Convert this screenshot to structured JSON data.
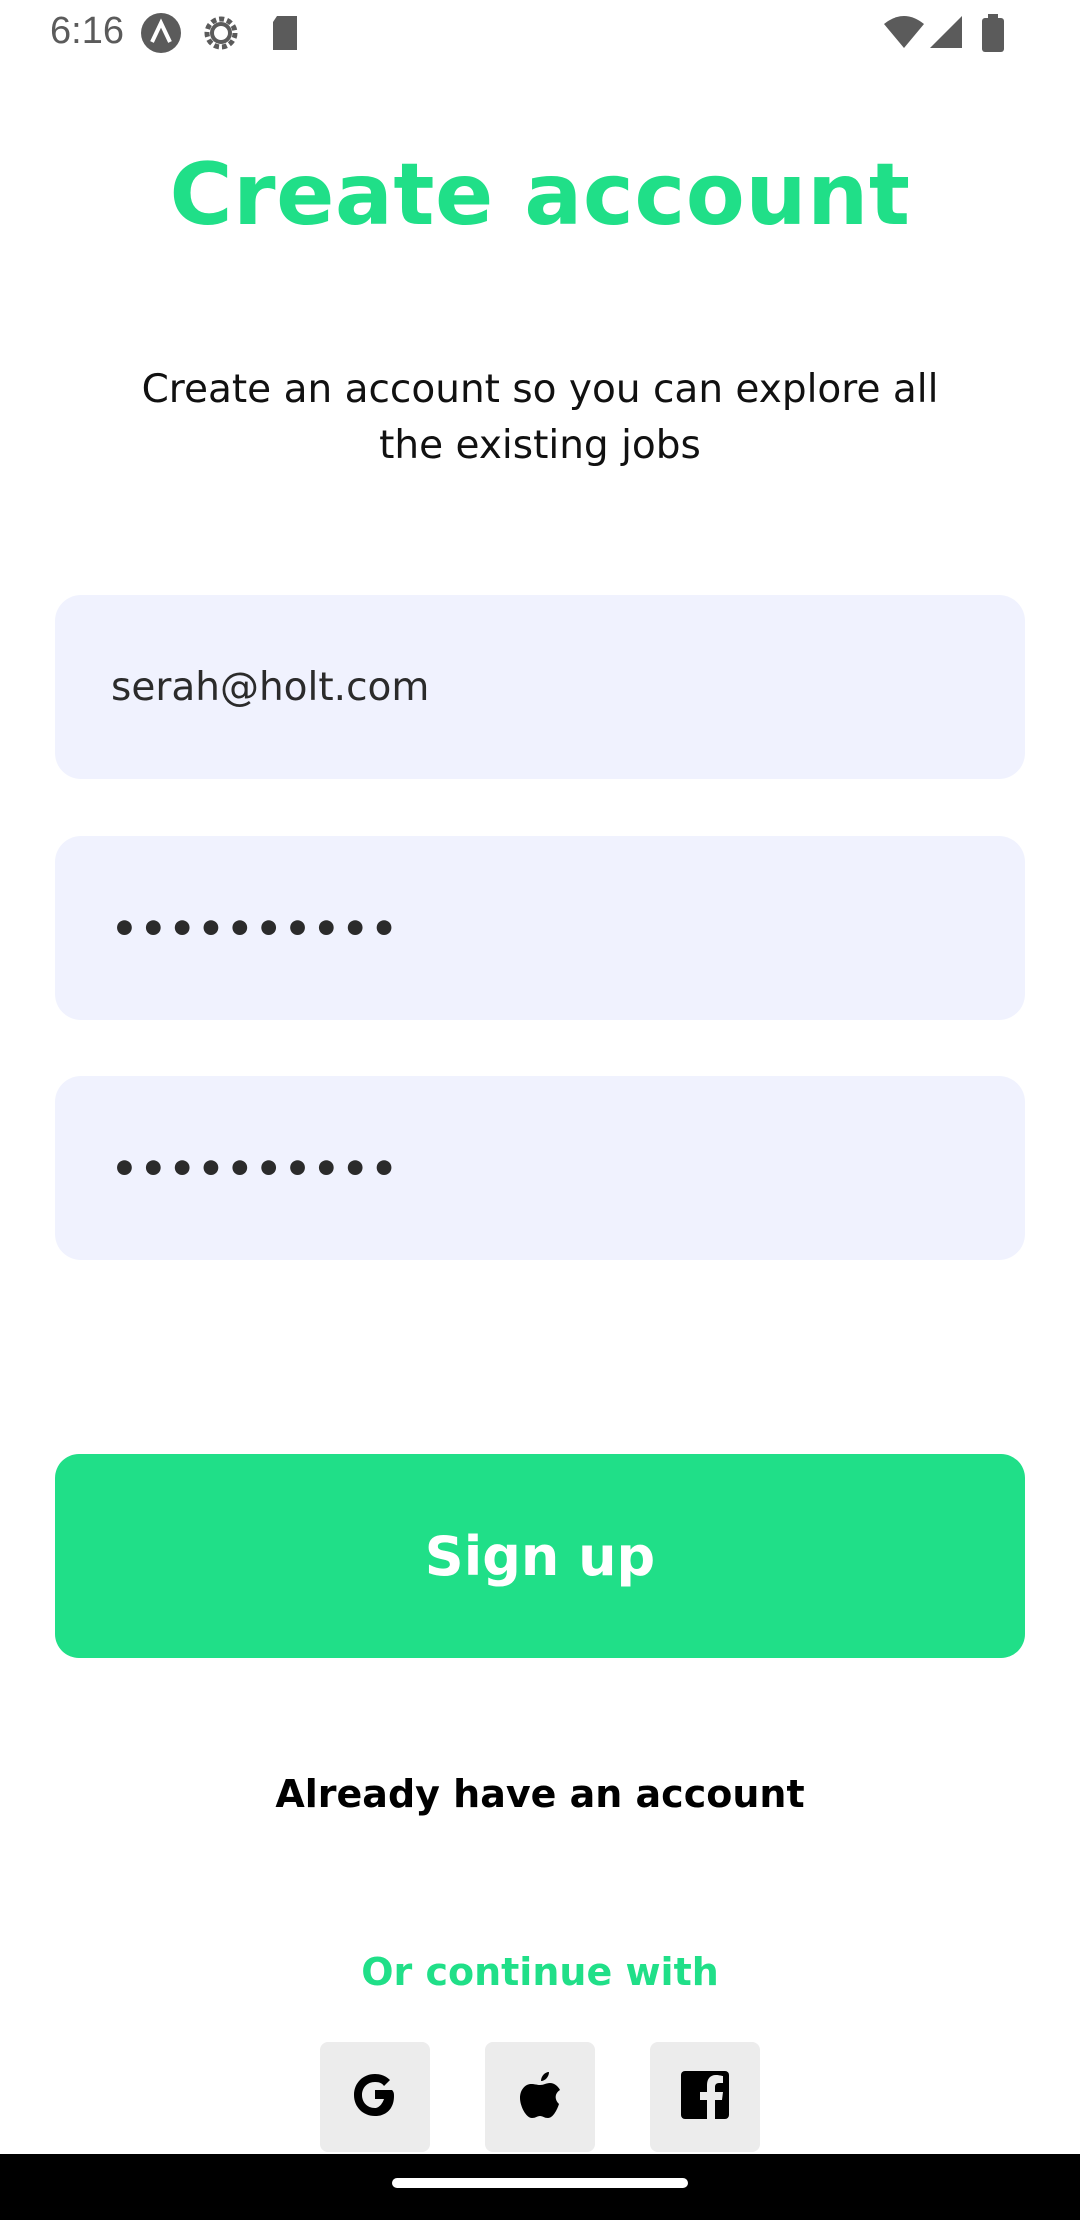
{
  "status_bar": {
    "time": "6:16",
    "left_icons": [
      "a-circle-icon",
      "settings-gear-icon",
      "sd-card-icon"
    ],
    "right_icons": [
      "wifi-icon",
      "signal-icon",
      "battery-icon"
    ]
  },
  "header": {
    "title": "Create account",
    "subtitle": "Create an account so you can explore all the existing jobs"
  },
  "form": {
    "email_value": "serah@holt.com",
    "password_value": "password12",
    "confirm_password_value": "password12"
  },
  "actions": {
    "signup_label": "Sign up",
    "already_label": "Already have an account",
    "continue_label": "Or continue with"
  },
  "social": [
    "google-icon",
    "apple-icon",
    "facebook-icon"
  ],
  "colors": {
    "accent": "#20DF88",
    "field_bg": "#F0F2FE",
    "social_bg": "#ECECEC"
  }
}
